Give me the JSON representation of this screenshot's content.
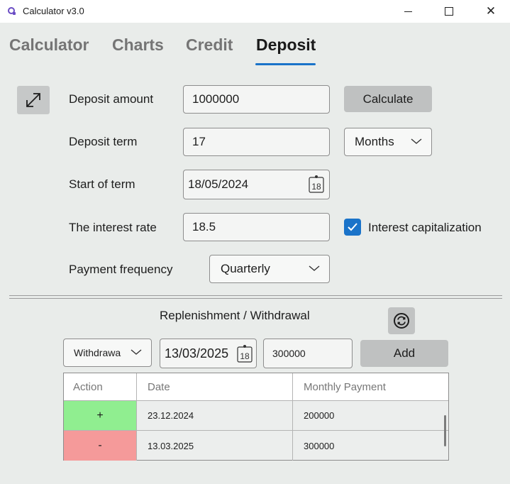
{
  "window": {
    "title": "Calculator v3.0",
    "minimize_icon": "minimize-icon",
    "maximize_icon": "maximize-icon",
    "close_glyph": "✕"
  },
  "tabs": [
    {
      "label": "Calculator",
      "active": false
    },
    {
      "label": "Charts",
      "active": false
    },
    {
      "label": "Credit",
      "active": false
    },
    {
      "label": "Deposit",
      "active": true
    }
  ],
  "form": {
    "deposit_amount": {
      "label": "Deposit amount",
      "value": "1000000"
    },
    "deposit_term": {
      "label": "Deposit term",
      "value": "17",
      "unit": "Months"
    },
    "start_of_term": {
      "label": "Start of term",
      "value": "18/05/2024",
      "calendar_day": "18"
    },
    "interest_rate": {
      "label": "The interest rate",
      "value": "18.5"
    },
    "interest_capitalization": {
      "label": "Interest capitalization",
      "checked": true
    },
    "payment_frequency": {
      "label": "Payment frequency",
      "value": "Quarterly"
    },
    "calculate_label": "Calculate"
  },
  "replenishment": {
    "title": "Replenishment / Withdrawal",
    "type_value": "Withdrawa",
    "date_value": "13/03/2025",
    "calendar_day": "18",
    "amount_value": "300000",
    "add_label": "Add"
  },
  "table": {
    "columns": [
      "Action",
      "Date",
      "Monthly Payment"
    ],
    "rows": [
      {
        "action": "+",
        "date": "23.12.2024",
        "payment": "200000",
        "color": "#90ee90"
      },
      {
        "action": "-",
        "date": "13.03.2025",
        "payment": "300000",
        "color": "#f59a9a"
      }
    ]
  },
  "colors": {
    "accent": "#1a73c9",
    "background": "#e9ecea",
    "replenish_row": "#90ee90",
    "withdraw_row": "#f59a9a"
  }
}
